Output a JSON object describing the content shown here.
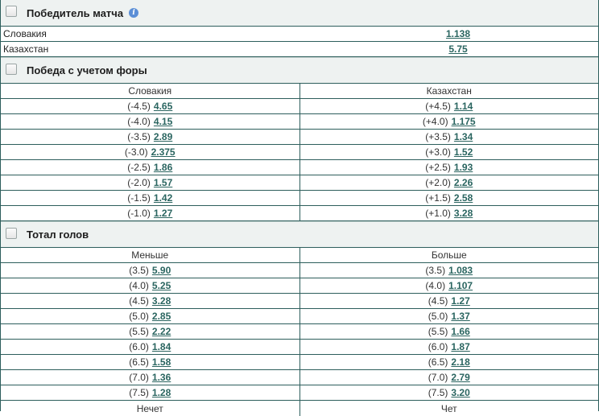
{
  "winner": {
    "title": "Победитель матча",
    "rows": [
      {
        "team": "Словакия",
        "odd": "1.138"
      },
      {
        "team": "Казахстан",
        "odd": "5.75"
      }
    ]
  },
  "handicap": {
    "title": "Победа с учетом форы",
    "headers": [
      "Словакия",
      "Казахстан"
    ],
    "rows": [
      {
        "l_line": "(-4.5)",
        "l_odd": "4.65",
        "r_line": "(+4.5)",
        "r_odd": "1.14"
      },
      {
        "l_line": "(-4.0)",
        "l_odd": "4.15",
        "r_line": "(+4.0)",
        "r_odd": "1.175"
      },
      {
        "l_line": "(-3.5)",
        "l_odd": "2.89",
        "r_line": "(+3.5)",
        "r_odd": "1.34"
      },
      {
        "l_line": "(-3.0)",
        "l_odd": "2.375",
        "r_line": "(+3.0)",
        "r_odd": "1.52"
      },
      {
        "l_line": "(-2.5)",
        "l_odd": "1.86",
        "r_line": "(+2.5)",
        "r_odd": "1.93"
      },
      {
        "l_line": "(-2.0)",
        "l_odd": "1.57",
        "r_line": "(+2.0)",
        "r_odd": "2.26"
      },
      {
        "l_line": "(-1.5)",
        "l_odd": "1.42",
        "r_line": "(+1.5)",
        "r_odd": "2.58"
      },
      {
        "l_line": "(-1.0)",
        "l_odd": "1.27",
        "r_line": "(+1.0)",
        "r_odd": "3.28"
      }
    ]
  },
  "totals": {
    "title": "Тотал голов",
    "headers": [
      "Меньше",
      "Больше"
    ],
    "rows": [
      {
        "l_line": "(3.5)",
        "l_odd": "5.90",
        "r_line": "(3.5)",
        "r_odd": "1.083"
      },
      {
        "l_line": "(4.0)",
        "l_odd": "5.25",
        "r_line": "(4.0)",
        "r_odd": "1.107"
      },
      {
        "l_line": "(4.5)",
        "l_odd": "3.28",
        "r_line": "(4.5)",
        "r_odd": "1.27"
      },
      {
        "l_line": "(5.0)",
        "l_odd": "2.85",
        "r_line": "(5.0)",
        "r_odd": "1.37"
      },
      {
        "l_line": "(5.5)",
        "l_odd": "2.22",
        "r_line": "(5.5)",
        "r_odd": "1.66"
      },
      {
        "l_line": "(6.0)",
        "l_odd": "1.84",
        "r_line": "(6.0)",
        "r_odd": "1.87"
      },
      {
        "l_line": "(6.5)",
        "l_odd": "1.58",
        "r_line": "(6.5)",
        "r_odd": "2.18"
      },
      {
        "l_line": "(7.0)",
        "l_odd": "1.36",
        "r_line": "(7.0)",
        "r_odd": "2.79"
      },
      {
        "l_line": "(7.5)",
        "l_odd": "1.28",
        "r_line": "(7.5)",
        "r_odd": "3.20"
      }
    ],
    "footer": [
      "Нечет",
      "Чет"
    ]
  },
  "icons": {
    "checkbox": "checkbox-icon",
    "info": "info-icon"
  },
  "colors": {
    "accent": "#2a6560",
    "border": "#2d5e5c",
    "header_bg": "#eef2f1"
  }
}
